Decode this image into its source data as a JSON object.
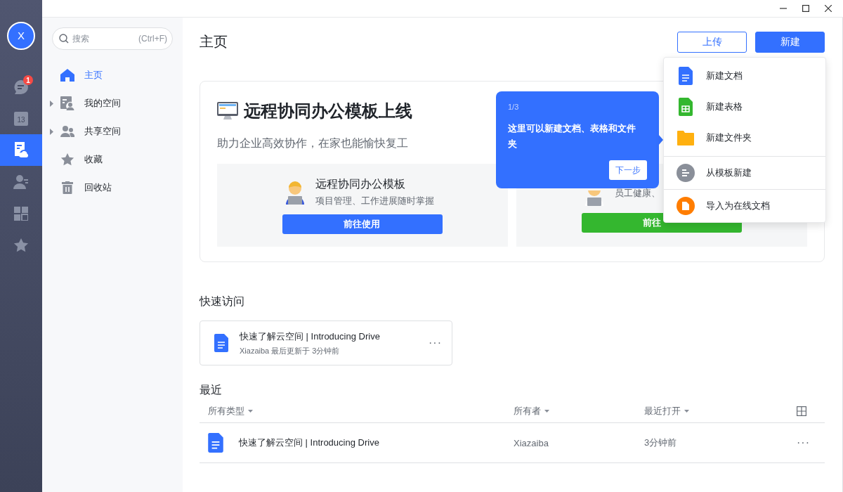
{
  "rail": {
    "avatar": "X",
    "items": [
      {
        "kind": "chat",
        "badge": "1",
        "selected": false
      },
      {
        "kind": "calendar",
        "label": "13",
        "selected": false
      },
      {
        "kind": "drive",
        "selected": true
      },
      {
        "kind": "contacts",
        "selected": false
      },
      {
        "kind": "apps",
        "selected": false
      },
      {
        "kind": "favorites",
        "selected": false
      }
    ]
  },
  "sidebar": {
    "search": {
      "placeholder": "搜索",
      "shortcut": "(Ctrl+F)"
    },
    "items": [
      {
        "label": "主页",
        "kind": "home",
        "selected": true,
        "expandable": false
      },
      {
        "label": "我的空间",
        "kind": "myspace",
        "selected": false,
        "expandable": true
      },
      {
        "label": "共享空间",
        "kind": "shared",
        "selected": false,
        "expandable": true
      },
      {
        "label": "收藏",
        "kind": "star",
        "selected": false,
        "expandable": false
      },
      {
        "label": "回收站",
        "kind": "trash",
        "selected": false,
        "expandable": false
      }
    ]
  },
  "header": {
    "title": "主页",
    "buttons": [
      {
        "label": "上传",
        "kind": "outline"
      },
      {
        "label": "新建",
        "kind": "primary"
      }
    ]
  },
  "banner": {
    "title": "远程协同办公模板上线",
    "subtitle": "助力企业高效协作，在家也能愉快复工",
    "cards": [
      {
        "title": "远程协同办公模板",
        "description": "项目管理、工作进展随时掌握",
        "button": "前往使用",
        "color": "#3370ff"
      },
      {
        "description": "员工健康、",
        "button": "前往",
        "color": "#34b72f"
      }
    ]
  },
  "tooltip": {
    "step": "1/3",
    "text": "这里可以新建文档、表格和文件夹",
    "button": "下一步"
  },
  "new_menu": {
    "sections": [
      {
        "items": [
          {
            "label": "新建文档",
            "kind": "doc"
          },
          {
            "label": "新建表格",
            "kind": "sheet"
          },
          {
            "label": "新建文件夹",
            "kind": "folder"
          }
        ]
      },
      {
        "items": [
          {
            "label": "从模板新建",
            "kind": "template"
          }
        ]
      },
      {
        "items": [
          {
            "label": "导入为在线文档",
            "kind": "import"
          }
        ]
      }
    ]
  },
  "quick_access": {
    "title": "快速访问",
    "items": [
      {
        "title": "快速了解云空间 | Introducing Drive",
        "meta": "Xiazaiba 最后更新于 3分钟前",
        "more": "···"
      }
    ]
  },
  "recent": {
    "title": "最近",
    "columns": [
      "所有类型",
      "所有者",
      "最近打开"
    ],
    "rows": [
      {
        "name": "快速了解云空间 | Introducing Drive",
        "owner": "Xiazaiba",
        "opened": "3分钟前",
        "more": "···"
      }
    ]
  }
}
